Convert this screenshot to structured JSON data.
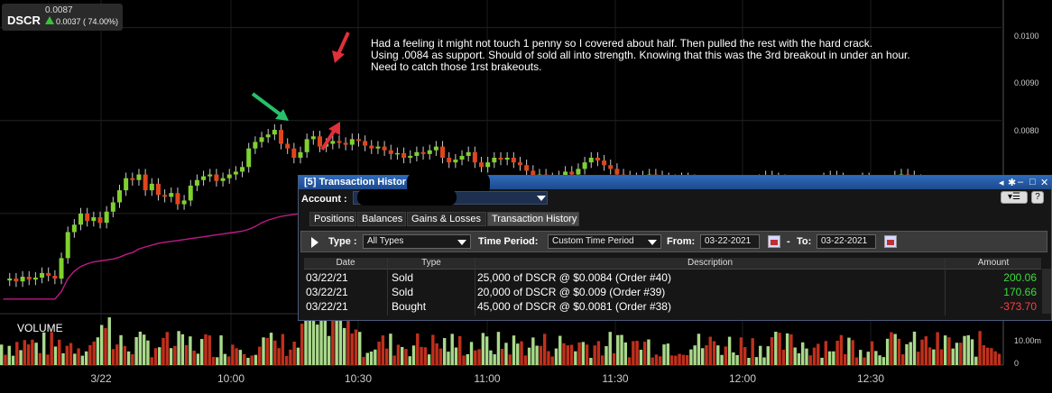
{
  "ticker": {
    "symbol": "DSCR",
    "last": "0.0087",
    "change": "0.0037 ( 74.00%)",
    "up_color": "#3cc03c"
  },
  "annotation": {
    "lines": [
      "Had a feeling it might not touch 1 penny so I covered about half. Then pulled the rest with the hard crack.",
      "Using .0084 as support. Should of sold all into strength. Knowing that this was the 3rd breakout in under an hour.",
      "Need to catch those 1rst brakeouts."
    ]
  },
  "volume_label": "VOLUME",
  "x_axis": [
    "3/22",
    "10:00",
    "10:30",
    "11:00",
    "11:30",
    "12:00",
    "12:30"
  ],
  "y_axis": [
    "0.0100",
    "0.0090",
    "0.0080"
  ],
  "vol_axis": [
    "10.00m",
    "0"
  ],
  "colors": {
    "up": "#7fd12e",
    "down": "#e0461c",
    "vwap": "#c0198a",
    "vol_up": "#a9d98a",
    "vol_down": "#c0301c",
    "win_title": "#2f6ab8"
  },
  "chart_data": {
    "type": "candlestick",
    "y_range": [
      0.007,
      0.0102
    ],
    "price_points": [
      0.00728,
      0.0073,
      0.00727,
      0.00732,
      0.00729,
      0.00731,
      0.00736,
      0.00733,
      0.0073,
      0.00752,
      0.0078,
      0.00788,
      0.008,
      0.00792,
      0.00796,
      0.0079,
      0.00802,
      0.00812,
      0.00825,
      0.00838,
      0.00836,
      0.00842,
      0.00825,
      0.00832,
      0.0082,
      0.00818,
      0.00822,
      0.0081,
      0.00814,
      0.0083,
      0.00836,
      0.0084,
      0.00842,
      0.00835,
      0.00838,
      0.00842,
      0.00845,
      0.0085,
      0.0087,
      0.00877,
      0.00882,
      0.00885,
      0.0089,
      0.00875,
      0.0087,
      0.0086,
      0.00866,
      0.0088,
      0.00883,
      0.00872,
      0.00875,
      0.00878,
      0.00876,
      0.00874,
      0.0088,
      0.00878,
      0.00873,
      0.0087,
      0.00872,
      0.00868,
      0.00864,
      0.00865,
      0.0086,
      0.00862,
      0.00866,
      0.00864,
      0.00868,
      0.00872,
      0.0086,
      0.00855,
      0.00858,
      0.00862,
      0.00866,
      0.00855,
      0.0085,
      0.00855,
      0.0086,
      0.00858,
      0.0086,
      0.00855,
      0.00852,
      0.00846,
      0.0084,
      0.00842,
      0.00838,
      0.00835,
      0.0084,
      0.00845,
      0.00842,
      0.00848,
      0.00855,
      0.0086,
      0.00857,
      0.00852,
      0.00848,
      0.00842,
      0.0084,
      0.00838,
      0.00836,
      0.0084,
      0.00842,
      0.0084,
      0.00838,
      0.00836,
      0.00834,
      0.00838,
      0.00836,
      0.00832,
      0.0083,
      0.00832,
      0.00834,
      0.0083,
      0.00828,
      0.0083,
      0.00825,
      0.0083,
      0.00832,
      0.00836,
      0.0084,
      0.00838,
      0.00836,
      0.00832,
      0.0083,
      0.00828,
      0.00826,
      0.0083,
      0.00835,
      0.00838,
      0.0084,
      0.00838,
      0.00835,
      0.0083,
      0.00835,
      0.00838,
      0.00835,
      0.0083,
      0.00828,
      0.00832,
      0.0084,
      0.00842,
      0.0084,
      0.00836,
      0.0083,
      0.008,
      0.0079,
      0.0078,
      0.00785,
      0.00795,
      0.008,
      0.00797,
      0.00798,
      0.00796,
      0.00802,
      0.008,
      0.00795
    ],
    "vwap": [
      0.00708,
      0.00708,
      0.00708,
      0.00708,
      0.00708,
      0.00708,
      0.00708,
      0.00708,
      0.00708,
      0.00716,
      0.0073,
      0.00738,
      0.00743,
      0.00746,
      0.00748,
      0.00749,
      0.0075,
      0.00751,
      0.00753,
      0.00756,
      0.00758,
      0.00762,
      0.00764,
      0.00766,
      0.00768,
      0.00769,
      0.0077,
      0.00771,
      0.00772,
      0.00773,
      0.00774,
      0.00775,
      0.00776,
      0.00777,
      0.00778,
      0.00779,
      0.0078,
      0.00781,
      0.00783,
      0.00786,
      0.0079,
      0.00793,
      0.00795,
      0.00797,
      0.00798,
      0.00799,
      0.008,
      0.00801,
      0.00802,
      0.00803,
      0.00804,
      0.00805,
      0.00806,
      0.00806,
      0.00807,
      0.00807,
      0.00808,
      0.00808,
      0.00808,
      0.00809,
      0.00809,
      0.00809,
      0.00809,
      0.0081,
      0.0081,
      0.0081,
      0.0081,
      0.0081,
      0.0081,
      0.0081,
      0.0081,
      0.0081,
      0.0081,
      0.0081,
      0.0081,
      0.0081,
      0.0081,
      0.0081,
      0.0081,
      0.0081,
      0.0081,
      0.0081,
      0.0081,
      0.0081,
      0.0081,
      0.0081,
      0.0081,
      0.0081,
      0.0081,
      0.0081,
      0.0081,
      0.0081,
      0.0081,
      0.0081,
      0.0081,
      0.0081,
      0.0081,
      0.0081,
      0.0081,
      0.0081,
      0.0081,
      0.0081,
      0.0081,
      0.0081,
      0.0081,
      0.0081,
      0.0081,
      0.0081,
      0.0081,
      0.0081,
      0.0081,
      0.0081,
      0.0081,
      0.0081,
      0.0081,
      0.0081,
      0.0081,
      0.0081,
      0.0081,
      0.0081,
      0.0081,
      0.0081,
      0.0081,
      0.0081,
      0.0081,
      0.0081,
      0.0081,
      0.0081,
      0.0081,
      0.0081,
      0.0081,
      0.0081,
      0.0081,
      0.0081,
      0.0081,
      0.0081,
      0.0081,
      0.0081,
      0.0081,
      0.0081,
      0.0081,
      0.0081,
      0.0081,
      0.0081,
      0.0081,
      0.0081,
      0.0081,
      0.0081,
      0.0081,
      0.0081,
      0.0081,
      0.0081,
      0.0081,
      0.0081,
      0.0081,
      0.0081
    ]
  },
  "window": {
    "title": "[5] Transaction Histor",
    "account_label": "Account :",
    "tabs": [
      "Positions",
      "Balances",
      "Gains & Losses",
      "Transaction History"
    ],
    "active_tab": 3,
    "filter": {
      "type_label": "Type :",
      "type_value": "All Types",
      "period_label": "Time Period:",
      "period_value": "Custom Time Period",
      "from_label": "From:",
      "from_value": "03-22-2021",
      "dash": "-",
      "to_label": "To:",
      "to_value": "03-22-2021"
    },
    "columns": [
      "Date",
      "Type",
      "Description",
      "Amount"
    ],
    "rows": [
      {
        "date": "03/22/21",
        "type": "Sold",
        "desc": "25,000 of DSCR @ $0.0084 (Order #40)",
        "amount": "200.06",
        "color": "#3cdc3c"
      },
      {
        "date": "03/22/21",
        "type": "Sold",
        "desc": "20,000 of DSCR @ $0.009 (Order #39)",
        "amount": "170.66",
        "color": "#3cdc3c"
      },
      {
        "date": "03/22/21",
        "type": "Bought",
        "desc": "45,000 of DSCR @ $0.0081 (Order #38)",
        "amount": "-373.70",
        "color": "#ff4040"
      }
    ]
  }
}
